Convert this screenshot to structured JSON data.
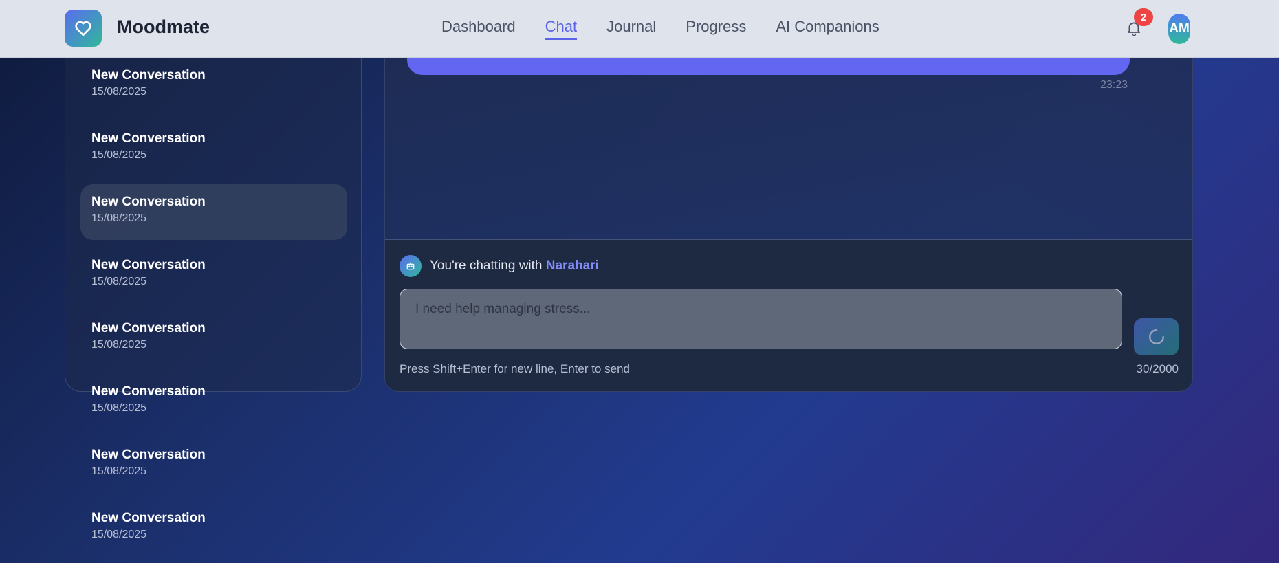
{
  "app": {
    "name": "Moodmate",
    "logo_icon": "heart-icon"
  },
  "nav": {
    "items": [
      {
        "label": "Dashboard",
        "active": false
      },
      {
        "label": "Chat",
        "active": true
      },
      {
        "label": "Journal",
        "active": false
      },
      {
        "label": "Progress",
        "active": false
      },
      {
        "label": "AI Companions",
        "active": false
      }
    ]
  },
  "header": {
    "notification_count": "2",
    "avatar_initials": "AM"
  },
  "sidebar": {
    "conversations": [
      {
        "title": "New Conversation",
        "date": "15/08/2025",
        "selected": false
      },
      {
        "title": "New Conversation",
        "date": "15/08/2025",
        "selected": false
      },
      {
        "title": "New Conversation",
        "date": "15/08/2025",
        "selected": true
      },
      {
        "title": "New Conversation",
        "date": "15/08/2025",
        "selected": false
      },
      {
        "title": "New Conversation",
        "date": "15/08/2025",
        "selected": false
      },
      {
        "title": "New Conversation",
        "date": "15/08/2025",
        "selected": false
      },
      {
        "title": "New Conversation",
        "date": "15/08/2025",
        "selected": false
      },
      {
        "title": "New Conversation",
        "date": "15/08/2025",
        "selected": false
      }
    ]
  },
  "chat": {
    "last_message_time": "23:23",
    "companion_prefix": "You're chatting with",
    "companion_name": "Narahari",
    "input_value": "I need help managing stress...",
    "hint": "Press Shift+Enter for new line, Enter to send",
    "char_count": "30/2000"
  },
  "colors": {
    "accent": "#6366f1",
    "nav_active": "#5b63e8",
    "badge": "#ef4444",
    "header_bg": "#dfe3ec"
  }
}
